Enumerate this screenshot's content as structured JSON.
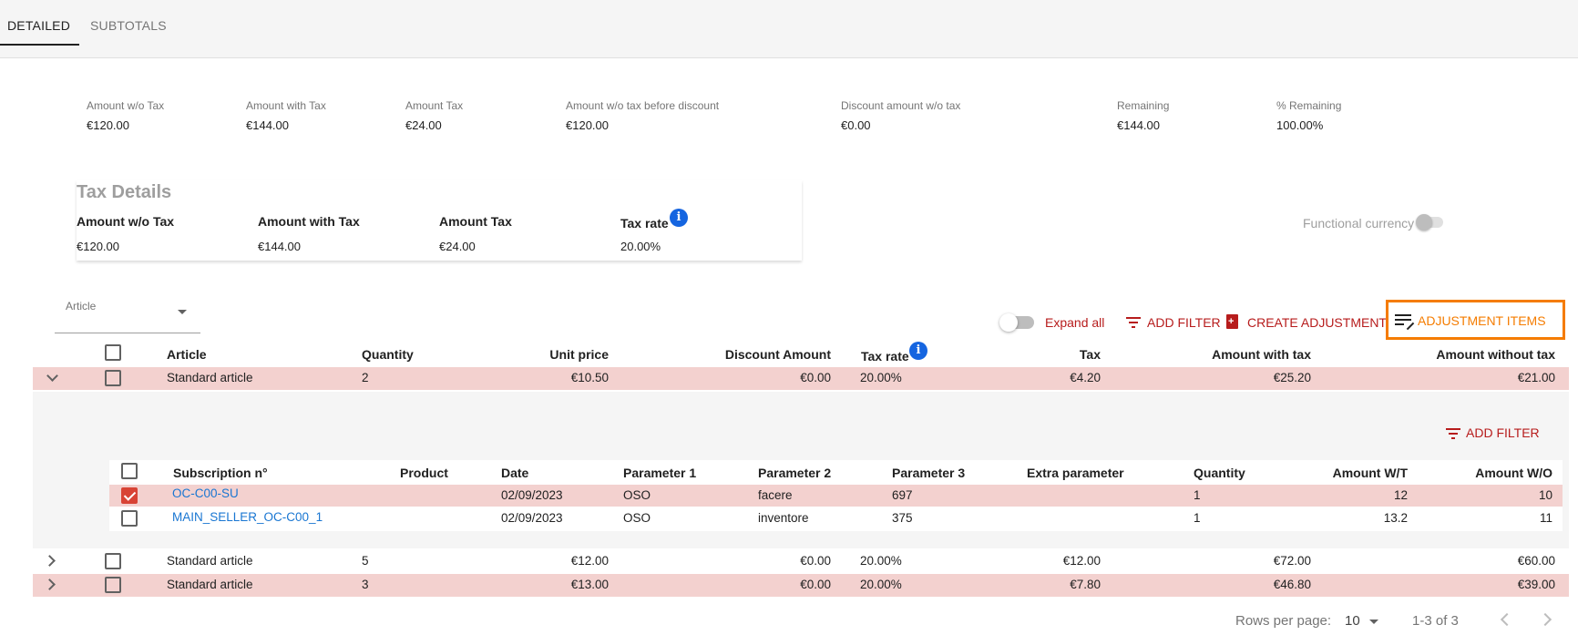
{
  "tabs": [
    "DETAILED",
    "SUBTOTALS"
  ],
  "summary": [
    {
      "label": "Amount w/o Tax",
      "value": "€120.00"
    },
    {
      "label": "Amount with Tax",
      "value": "€144.00"
    },
    {
      "label": "Amount Tax",
      "value": "€24.00"
    },
    {
      "label": "Amount w/o tax before discount",
      "value": "€120.00"
    },
    {
      "label": "Discount amount w/o tax",
      "value": "€0.00"
    },
    {
      "label": "Remaining",
      "value": "€144.00"
    },
    {
      "label": "% Remaining",
      "value": "100.00%"
    }
  ],
  "tax_details": {
    "title": "Tax Details",
    "headers": [
      "Amount w/o Tax",
      "Amount with Tax",
      "Amount Tax",
      "Tax rate"
    ],
    "values": [
      "€120.00",
      "€144.00",
      "€24.00",
      "20.00%"
    ]
  },
  "functional_currency_label": "Functional currency",
  "article_select": {
    "label": "Article",
    "value": ""
  },
  "toolbar": {
    "expand_all": "Expand all",
    "add_filter": "ADD FILTER",
    "create_adjustment": "CREATE ADJUSTMENT",
    "adjustment_items": "ADJUSTMENT ITEMS"
  },
  "table": {
    "headers": [
      "Article",
      "Quantity",
      "Unit price",
      "Discount Amount",
      "Tax rate",
      "Tax",
      "Amount with tax",
      "Amount without tax"
    ],
    "rows": [
      [
        "Standard article",
        "2",
        "€10.50",
        "€0.00",
        "20.00%",
        "€4.20",
        "€25.20",
        "€21.00"
      ],
      [
        "Standard article",
        "5",
        "€12.00",
        "€0.00",
        "20.00%",
        "€12.00",
        "€72.00",
        "€60.00"
      ],
      [
        "Standard article",
        "3",
        "€13.00",
        "€0.00",
        "20.00%",
        "€7.80",
        "€46.80",
        "€39.00"
      ]
    ]
  },
  "sub_table": {
    "add_filter": "ADD FILTER",
    "headers": [
      "Subscription n°",
      "Product",
      "Date",
      "Parameter 1",
      "Parameter 2",
      "Parameter 3",
      "Extra parameter",
      "Quantity",
      "Amount W/T",
      "Amount W/O"
    ],
    "rows": [
      [
        "OC-C00-SU",
        "",
        "02/09/2023",
        "OSO",
        "facere",
        "697",
        "",
        "1",
        "12",
        "10"
      ],
      [
        "MAIN_SELLER_OC-C00_1",
        "",
        "02/09/2023",
        "OSO",
        "inventore",
        "375",
        "",
        "1",
        "13.2",
        "11"
      ]
    ]
  },
  "pagination": {
    "rows_per_page_label": "Rows per page:",
    "rows_per_page": "10",
    "range": "1-3 of 3"
  }
}
